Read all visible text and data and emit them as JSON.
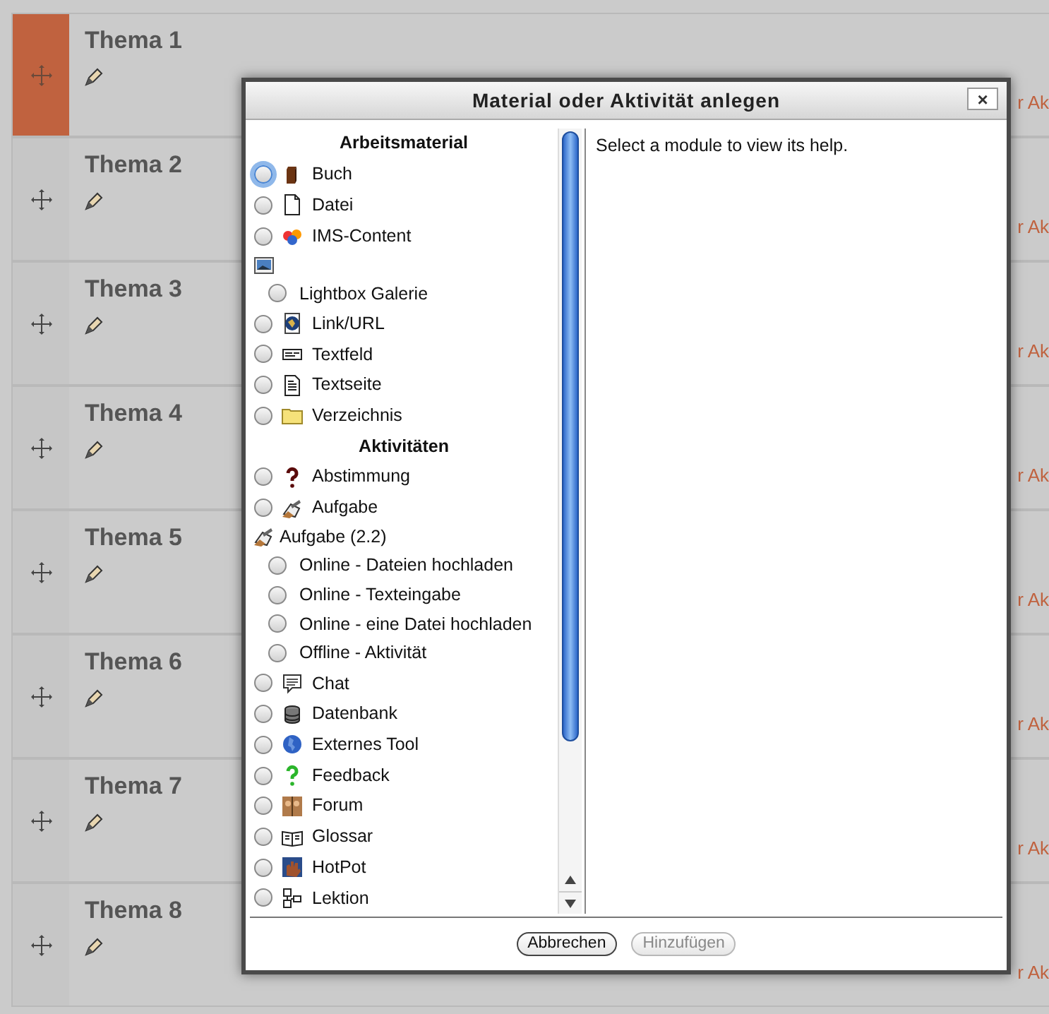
{
  "sections": [
    {
      "title": "Thema 1",
      "highlighted": true,
      "link": "r Ak"
    },
    {
      "title": "Thema 2",
      "highlighted": false,
      "link": "r Ak"
    },
    {
      "title": "Thema 3",
      "highlighted": false,
      "link": "r Ak"
    },
    {
      "title": "Thema 4",
      "highlighted": false,
      "link": "r Ak"
    },
    {
      "title": "Thema 5",
      "highlighted": false,
      "link": "r Ak"
    },
    {
      "title": "Thema 6",
      "highlighted": false,
      "link": "r Ak"
    },
    {
      "title": "Thema 7",
      "highlighted": false,
      "link": "r Ak"
    },
    {
      "title": "Thema 8",
      "highlighted": false,
      "link": "r Ak"
    }
  ],
  "dialog": {
    "title": "Material oder Aktivität anlegen",
    "close": "×",
    "help": "Select a module to view its help.",
    "items": [
      {
        "kind": "header",
        "label": "Arbeitsmaterial"
      },
      {
        "kind": "module",
        "label": "Buch",
        "focused": true
      },
      {
        "kind": "module",
        "label": "Datei",
        "focused": false
      },
      {
        "kind": "module",
        "label": "IMS-Content",
        "focused": false
      },
      {
        "kind": "group",
        "children": [
          {
            "label": "Lightbox Galerie",
            "focused": false
          }
        ]
      },
      {
        "kind": "module",
        "label": "Link/URL",
        "focused": false
      },
      {
        "kind": "module",
        "label": "Textfeld",
        "focused": false
      },
      {
        "kind": "module",
        "label": "Textseite",
        "focused": false
      },
      {
        "kind": "module",
        "label": "Verzeichnis",
        "focused": false
      },
      {
        "kind": "header",
        "label": "Aktivitäten"
      },
      {
        "kind": "module",
        "label": "Abstimmung",
        "focused": false
      },
      {
        "kind": "module",
        "label": "Aufgabe",
        "focused": false
      },
      {
        "kind": "group",
        "label": "Aufgabe (2.2)",
        "children": [
          {
            "label": "Online - Dateien hochladen",
            "focused": false
          },
          {
            "label": "Online - Texteingabe",
            "focused": false
          },
          {
            "label": "Online - eine Datei hochladen",
            "focused": false
          },
          {
            "label": "Offline - Aktivität",
            "focused": false
          }
        ]
      },
      {
        "kind": "module",
        "label": "Chat",
        "focused": false
      },
      {
        "kind": "module",
        "label": "Datenbank",
        "focused": false
      },
      {
        "kind": "module",
        "label": "Externes Tool",
        "focused": false
      },
      {
        "kind": "module",
        "label": "Feedback",
        "focused": false
      },
      {
        "kind": "module",
        "label": "Forum",
        "focused": false
      },
      {
        "kind": "module",
        "label": "Glossar",
        "focused": false
      },
      {
        "kind": "module",
        "label": "HotPot",
        "focused": false
      },
      {
        "kind": "module",
        "label": "Lektion",
        "focused": false
      }
    ],
    "buttons": [
      {
        "label": "Abbrechen",
        "disabled": false
      },
      {
        "label": "Hinzufügen",
        "disabled": true
      }
    ]
  }
}
